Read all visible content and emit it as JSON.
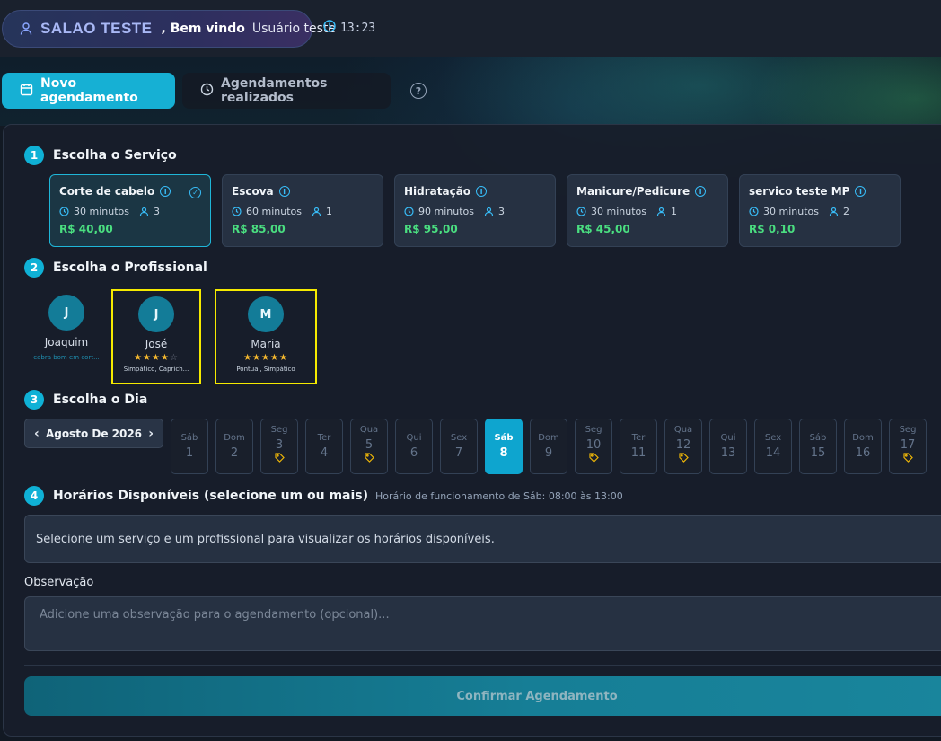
{
  "header": {
    "salon_name": "SALAO TESTE",
    "welcome": ", Bem vindo",
    "user_name": "Usuário teste",
    "time": "13:23"
  },
  "tabs": [
    {
      "label": "Novo agendamento",
      "active": true,
      "icon": "calendar-icon"
    },
    {
      "label": "Agendamentos realizados",
      "active": false,
      "icon": "clock-icon"
    }
  ],
  "steps": {
    "service": {
      "num": "1",
      "title": "Escolha o Serviço"
    },
    "professional": {
      "num": "2",
      "title": "Escolha o Profissional"
    },
    "day": {
      "num": "3",
      "title": "Escolha o Dia"
    },
    "slots": {
      "num": "4",
      "title": "Horários Disponíveis (selecione um ou mais)",
      "note": "Horário de funcionamento de Sáb: 08:00 às 13:00"
    }
  },
  "services": [
    {
      "name": "Corte de cabelo",
      "duration": "30 minutos",
      "pros": "3",
      "price": "R$ 40,00",
      "selected": true
    },
    {
      "name": "Escova",
      "duration": "60 minutos",
      "pros": "1",
      "price": "R$ 85,00",
      "selected": false
    },
    {
      "name": "Hidratação",
      "duration": "90 minutos",
      "pros": "3",
      "price": "R$ 95,00",
      "selected": false
    },
    {
      "name": "Manicure/Pedicure",
      "duration": "30 minutos",
      "pros": "1",
      "price": "R$ 45,00",
      "selected": false
    },
    {
      "name": "servico teste MP",
      "duration": "30 minutos",
      "pros": "2",
      "price": "R$ 0,10",
      "selected": false
    }
  ],
  "professionals": [
    {
      "initial": "J",
      "name": "Joaquim",
      "rating": 0,
      "tags": "cabra bom em cort..."
    },
    {
      "initial": "J",
      "name": "José",
      "rating": 4,
      "tags": "Simpático, Caprich..."
    },
    {
      "initial": "M",
      "name": "Maria",
      "rating": 5,
      "tags": "Pontual, Simpático"
    }
  ],
  "calendar": {
    "month_label": "Agosto De 2026",
    "days": [
      {
        "weekday": "Sáb",
        "day": "1",
        "promo": false,
        "selected": false
      },
      {
        "weekday": "Dom",
        "day": "2",
        "promo": false,
        "selected": false
      },
      {
        "weekday": "Seg",
        "day": "3",
        "promo": true,
        "selected": false
      },
      {
        "weekday": "Ter",
        "day": "4",
        "promo": false,
        "selected": false
      },
      {
        "weekday": "Qua",
        "day": "5",
        "promo": true,
        "selected": false
      },
      {
        "weekday": "Qui",
        "day": "6",
        "promo": false,
        "selected": false
      },
      {
        "weekday": "Sex",
        "day": "7",
        "promo": false,
        "selected": false
      },
      {
        "weekday": "Sáb",
        "day": "8",
        "promo": false,
        "selected": true
      },
      {
        "weekday": "Dom",
        "day": "9",
        "promo": false,
        "selected": false
      },
      {
        "weekday": "Seg",
        "day": "10",
        "promo": true,
        "selected": false
      },
      {
        "weekday": "Ter",
        "day": "11",
        "promo": false,
        "selected": false
      },
      {
        "weekday": "Qua",
        "day": "12",
        "promo": true,
        "selected": false
      },
      {
        "weekday": "Qui",
        "day": "13",
        "promo": false,
        "selected": false
      },
      {
        "weekday": "Sex",
        "day": "14",
        "promo": false,
        "selected": false
      },
      {
        "weekday": "Sáb",
        "day": "15",
        "promo": false,
        "selected": false
      },
      {
        "weekday": "Dom",
        "day": "16",
        "promo": false,
        "selected": false
      },
      {
        "weekday": "Seg",
        "day": "17",
        "promo": true,
        "selected": false
      }
    ]
  },
  "slots": {
    "message": "Selecione um serviço e um profissional para visualizar os horários disponíveis."
  },
  "observation": {
    "label": "Observação",
    "placeholder": "Adicione uma observação para o agendamento (opcional)..."
  },
  "confirm_label": "Confirmar Agendamento",
  "colors": {
    "accent": "#16b0d4",
    "price": "#4ade80",
    "star": "#f5b82e",
    "highlight": "#f5ea00"
  }
}
